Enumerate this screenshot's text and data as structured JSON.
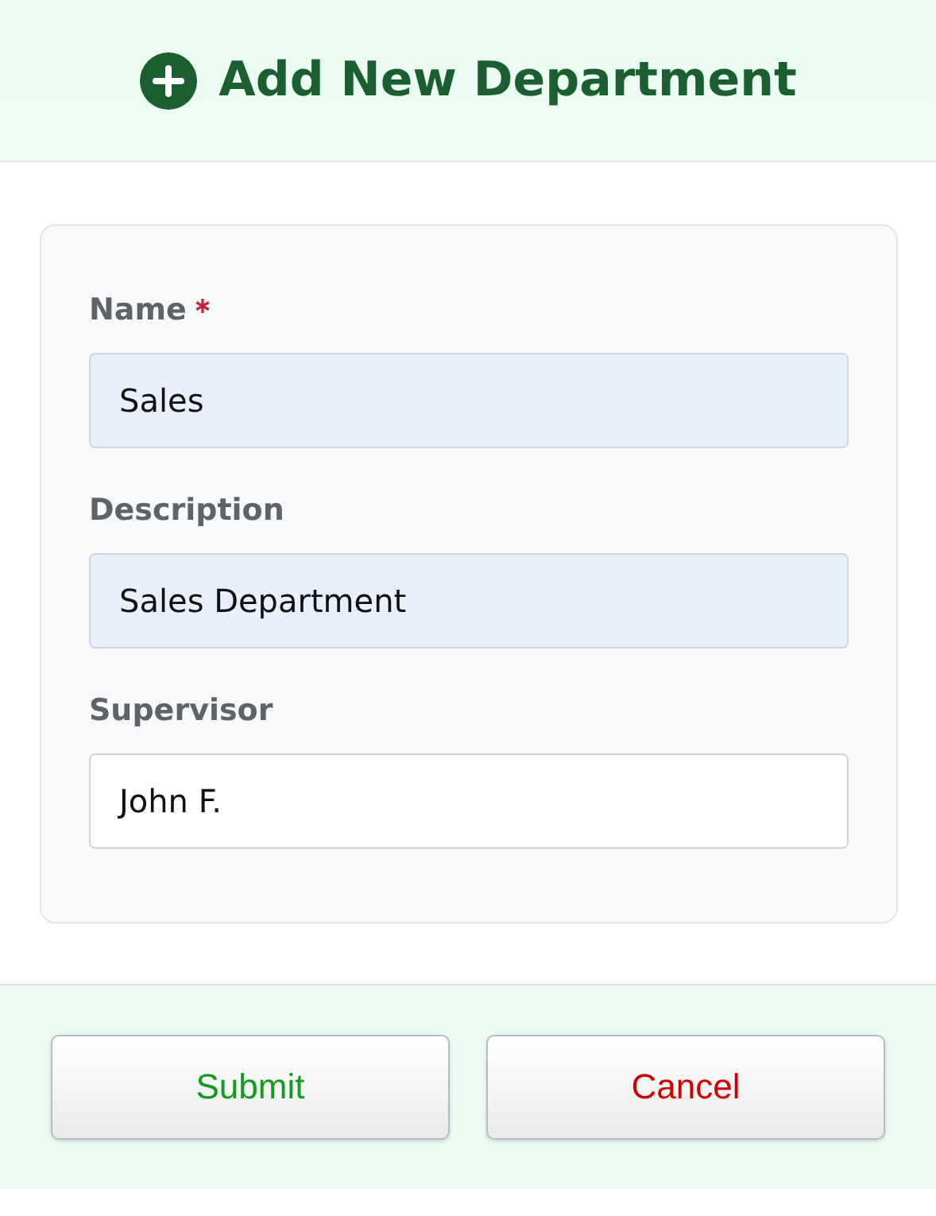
{
  "header": {
    "title": "Add New Department"
  },
  "fields": [
    {
      "label": "Name",
      "required": true,
      "value": "Sales",
      "autofilled": true
    },
    {
      "label": "Description",
      "required": false,
      "value": "Sales Department",
      "autofilled": true
    },
    {
      "label": "Supervisor",
      "required": false,
      "value": "John F.",
      "autofilled": false
    }
  ],
  "buttons": [
    {
      "label": "Submit",
      "kind": "submit"
    },
    {
      "label": "Cancel",
      "kind": "cancel"
    }
  ]
}
